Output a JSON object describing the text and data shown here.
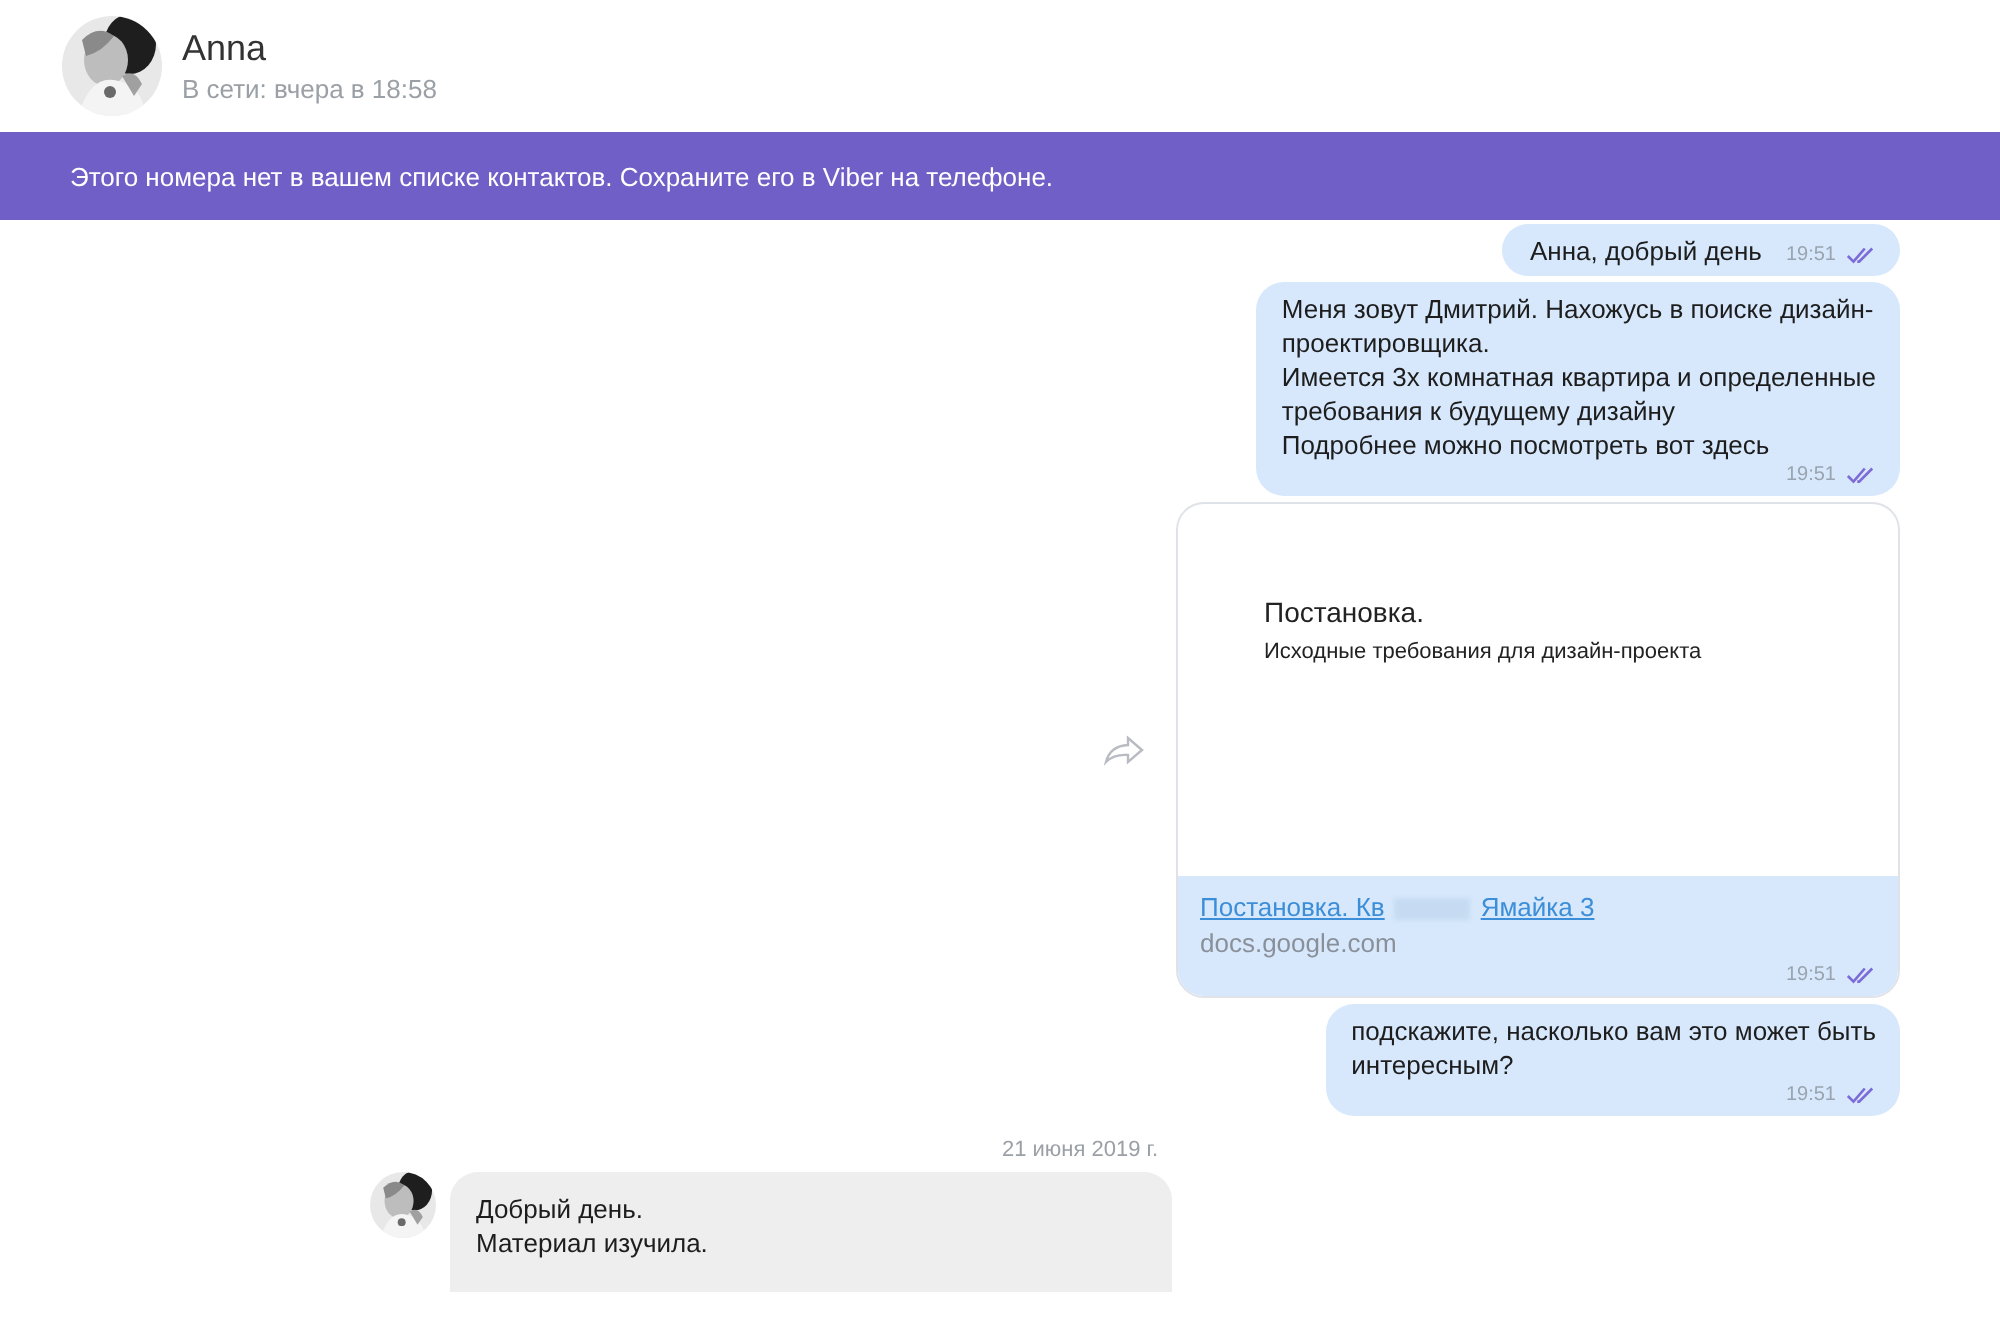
{
  "contact": {
    "name": "Anna",
    "status": "В сети: вчера в 18:58"
  },
  "banner": "Этого номера нет в вашем списке контактов. Сохраните его в Viber на телефоне.",
  "messages": [
    {
      "kind": "outgoing",
      "lines": [
        "Анна, добрый день"
      ],
      "time": "19:51",
      "read": true
    },
    {
      "kind": "outgoing",
      "lines": [
        "Меня зовут Дмитрий. Нахожусь в поиске дизайн-",
        "проектировщика.",
        "Имеется 3х комнатная квартира и определенные",
        "требования к будущему дизайну",
        "Подробнее можно посмотреть вот здесь"
      ],
      "time": "19:51",
      "read": true
    },
    {
      "kind": "link",
      "preview_title": "Постановка.",
      "preview_subtitle": "Исходные требования для дизайн-проекта",
      "link_parts": [
        "Постановка. Кв",
        "Ямайка 3"
      ],
      "domain": "docs.google.com",
      "time": "19:51",
      "read": true
    },
    {
      "kind": "outgoing",
      "lines": [
        "подскажите, насколько вам это может быть",
        "интересным?"
      ],
      "time": "19:51",
      "read": true
    },
    {
      "kind": "date",
      "text": "21 июня 2019 г."
    },
    {
      "kind": "incoming",
      "lines": [
        "Добрый день.",
        "Материал изучила."
      ]
    }
  ]
}
